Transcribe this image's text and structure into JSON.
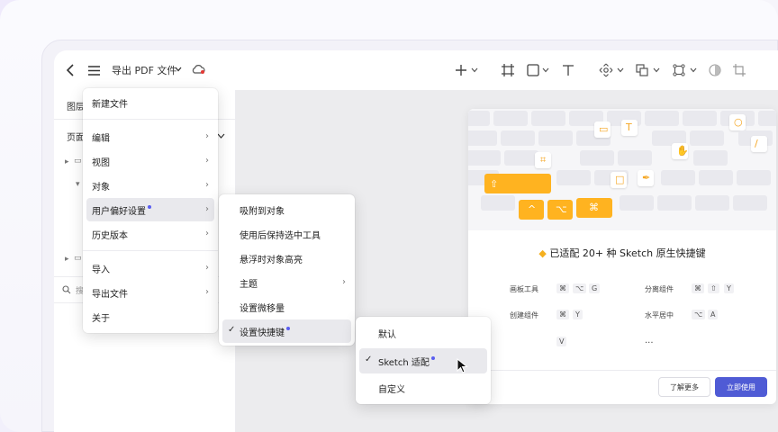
{
  "toolbar": {
    "doc_title": "导出 PDF 文件"
  },
  "left_panel": {
    "tab_layers": "图层",
    "pages_label": "页面",
    "search_placeholder": "搜"
  },
  "main_menu": {
    "items": [
      {
        "label": "新建文件"
      },
      {
        "label": "编辑"
      },
      {
        "label": "视图"
      },
      {
        "label": "对象"
      },
      {
        "label": "用户偏好设置"
      },
      {
        "label": "历史版本"
      },
      {
        "label": "导入"
      },
      {
        "label": "导出文件"
      },
      {
        "label": "关于"
      }
    ]
  },
  "pref_menu": {
    "items": [
      {
        "label": "吸附到对象"
      },
      {
        "label": "使用后保持选中工具"
      },
      {
        "label": "悬浮时对象高亮"
      },
      {
        "label": "主题"
      },
      {
        "label": "设置微移量"
      },
      {
        "label": "设置快捷键"
      }
    ]
  },
  "shortcut_menu": {
    "items": [
      {
        "label": "默认"
      },
      {
        "label": "Sketch 适配"
      },
      {
        "label": "自定义"
      }
    ]
  },
  "welcome": {
    "headline": "已适配 20+ 种 Sketch 原生快捷键",
    "shortcuts": [
      {
        "label": "画板工具",
        "keys": [
          "⌘",
          "⌥",
          "G"
        ]
      },
      {
        "label": "分离组件",
        "keys": [
          "⌘",
          "⇧",
          "Y"
        ]
      },
      {
        "label": "创建组件",
        "keys": [
          "⌘",
          "Y"
        ]
      },
      {
        "label": "水平居中",
        "keys": [
          "⌥",
          "A"
        ]
      }
    ],
    "partial_key": "V",
    "more": "...",
    "learn_more": "了解更多",
    "use_now": "立即使用"
  },
  "colors": {
    "accent": "#4f5bd5",
    "dot": "#5a5ef0",
    "key_orange": "#ffb320"
  }
}
